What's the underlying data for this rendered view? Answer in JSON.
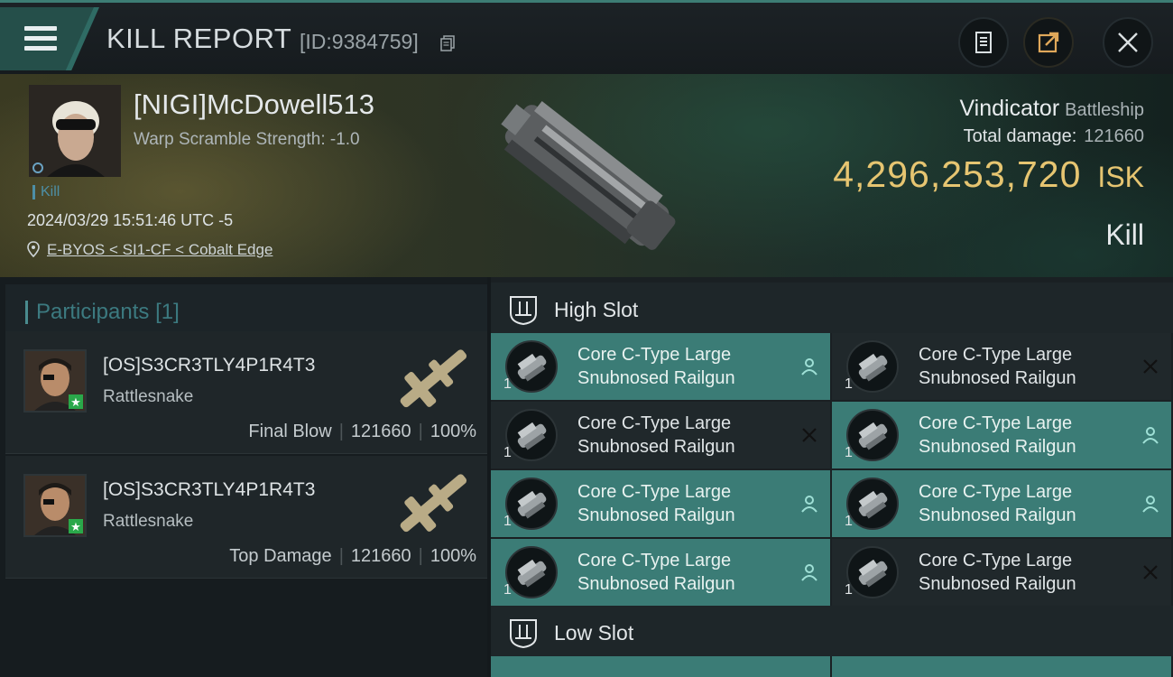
{
  "header": {
    "title": "KILL REPORT",
    "report_id": "[ID:9384759]"
  },
  "victim": {
    "name": "[NIGI]McDowell513",
    "warp_scramble": "Warp Scramble Strength: -1.0",
    "tag": "Kill",
    "datetime": "2024/03/29 15:51:46 UTC -5",
    "location": "E-BYOS < SI1-CF < Cobalt Edge",
    "ship_name": "Vindicator",
    "ship_class": "Battleship",
    "total_damage_label": "Total damage:",
    "total_damage": "121660",
    "isk_value": "4,296,253,720",
    "isk_unit": "ISK",
    "kill_type": "Kill"
  },
  "participants": {
    "title": "Participants",
    "count": "[1]",
    "rows": [
      {
        "name": "[OS]S3CR3TLY4P1R4T3",
        "ship": "Rattlesnake",
        "role": "Final Blow",
        "damage": "121660",
        "percent": "100%"
      },
      {
        "name": "[OS]S3CR3TLY4P1R4T3",
        "ship": "Rattlesnake",
        "role": "Top Damage",
        "damage": "121660",
        "percent": "100%"
      }
    ]
  },
  "slots": {
    "high_title": "High Slot",
    "low_title": "Low Slot",
    "high_modules": [
      {
        "line1": "Core C-Type Large",
        "line2": "Snubnosed Railgun",
        "qty": "1",
        "status": "fitted"
      },
      {
        "line1": "Core C-Type Large",
        "line2": "Snubnosed Railgun",
        "qty": "1",
        "status": "destroyed"
      },
      {
        "line1": "Core C-Type Large",
        "line2": "Snubnosed Railgun",
        "qty": "1",
        "status": "destroyed"
      },
      {
        "line1": "Core C-Type Large",
        "line2": "Snubnosed Railgun",
        "qty": "1",
        "status": "fitted"
      },
      {
        "line1": "Core C-Type Large",
        "line2": "Snubnosed Railgun",
        "qty": "1",
        "status": "fitted"
      },
      {
        "line1": "Core C-Type Large",
        "line2": "Snubnosed Railgun",
        "qty": "1",
        "status": "fitted"
      },
      {
        "line1": "Core C-Type Large",
        "line2": "Snubnosed Railgun",
        "qty": "1",
        "status": "fitted"
      },
      {
        "line1": "Core C-Type Large",
        "line2": "Snubnosed Railgun",
        "qty": "1",
        "status": "destroyed"
      }
    ]
  },
  "colors": {
    "accent": "#3b7c76",
    "isk": "#e6c571"
  }
}
